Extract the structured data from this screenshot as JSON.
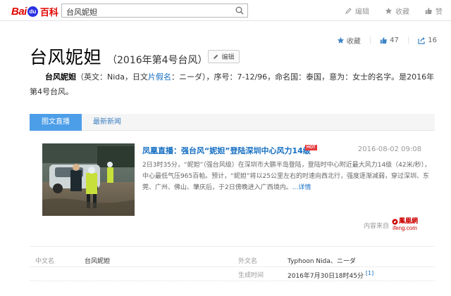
{
  "header": {
    "logo": {
      "prefix": "Bai",
      "paw": "du",
      "suffix": "百科"
    },
    "search_value": "台风妮妲",
    "actions": [
      {
        "label": "编辑",
        "icon": "pencil-icon"
      },
      {
        "label": "收藏",
        "icon": "star-icon"
      },
      {
        "label": "赞",
        "icon": "thumb-icon"
      }
    ]
  },
  "entry": {
    "title": "台风妮妲",
    "subtitle": "（2016年第4号台风）",
    "edit_label": "编辑",
    "stats": {
      "favorite_label": "收藏",
      "likes": "47",
      "shares": "16"
    }
  },
  "summary": {
    "name": "台风妮妲",
    "part1": "（英文：Nida，日文",
    "link": "片假名",
    "part2": "：ニーダ），序号：7-12/96，命名国：泰国，意为：女士的名字。是2016年第4号台风。"
  },
  "tabs": [
    {
      "label": "图文直播",
      "active": true
    },
    {
      "label": "最新新闻",
      "active": false
    }
  ],
  "news": {
    "title": "凤凰直播：强台风“妮妲”登陆深圳中心风力14级",
    "badge": "HOT",
    "date": "2016-08-02 09:08",
    "body": "2日3时35分，“妮妲”（强台风级）在深圳市大鹏半岛登陆，登陆时中心附近最大风力14级（42米/秒），中心最低气压965百帕。预计，“妮妲”将以25公里左右的时速向西北行，强度逐渐减弱，穿过深圳、东莞、广州、佛山、肇庆后，于2日傍晚进入广西境内。",
    "more": "...详情",
    "source_label": "内容来自",
    "source_cn": "鳳凰網",
    "source_en": "ifeng.com"
  },
  "info": {
    "rows": [
      {
        "k1": "中文名",
        "v1": "台风妮妲",
        "k2": "外文名",
        "v2": "Typhoon Nida、ニーダ"
      },
      {
        "k1": "",
        "v1": "",
        "k2": "生成时间",
        "v2": "2016年7月30日18时45分",
        "ref": "[1]"
      }
    ]
  },
  "colors": {
    "baidu_red": "#e10601",
    "baidu_blue": "#2932e1",
    "link_blue": "#136ec2",
    "tab_active": "#4d9ee8",
    "hot_red": "#e4393c"
  }
}
